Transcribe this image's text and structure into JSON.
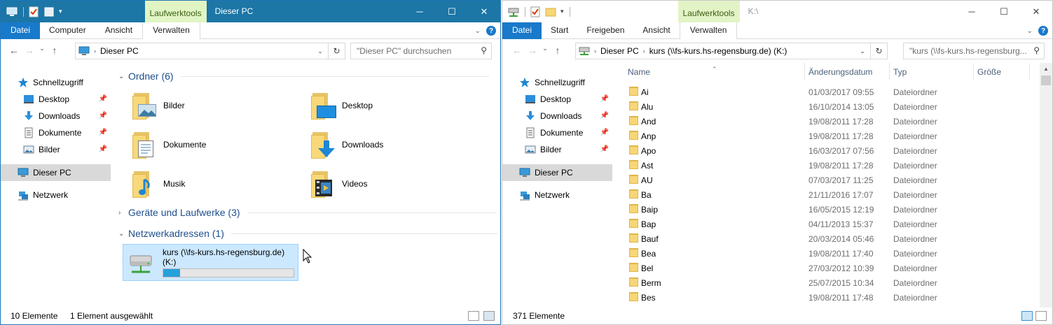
{
  "left": {
    "context_tab": "Laufwerktools",
    "title": "Dieser PC",
    "ribbon_tabs": [
      "Datei",
      "Computer",
      "Ansicht",
      "Verwalten"
    ],
    "address": "Dieser PC",
    "search_placeholder": "\"Dieser PC\" durchsuchen",
    "nav": {
      "quick_access": "Schnellzugriff",
      "items": [
        "Desktop",
        "Downloads",
        "Dokumente",
        "Bilder"
      ],
      "this_pc": "Dieser PC",
      "network": "Netzwerk"
    },
    "groups": {
      "folders": "Ordner (6)",
      "devices": "Geräte und Laufwerke (3)",
      "network": "Netzwerkadressen (1)"
    },
    "folders": [
      "Bilder",
      "Desktop",
      "Dokumente",
      "Downloads",
      "Musik",
      "Videos"
    ],
    "network_drive": {
      "line1": "kurs (\\\\fs-kurs.hs-regensburg.de)",
      "line2": "(K:)",
      "used_fraction": 0.13
    },
    "status": {
      "count": "10 Elemente",
      "selected": "1 Element ausgewählt"
    }
  },
  "right": {
    "context_tab": "Laufwerktools",
    "title": "K:\\",
    "ribbon_tabs": [
      "Datei",
      "Start",
      "Freigeben",
      "Ansicht",
      "Verwalten"
    ],
    "address": {
      "crumb1": "Dieser PC",
      "crumb2": "kurs (\\\\fs-kurs.hs-regensburg.de) (K:)"
    },
    "search_placeholder": "\"kurs (\\\\fs-kurs.hs-regensburg...",
    "nav": {
      "quick_access": "Schnellzugriff",
      "items": [
        "Desktop",
        "Downloads",
        "Dokumente",
        "Bilder"
      ],
      "this_pc": "Dieser PC",
      "network": "Netzwerk"
    },
    "columns": [
      "Name",
      "Änderungsdatum",
      "Typ",
      "Größe"
    ],
    "rows": [
      {
        "name": "Ai",
        "date": "01/03/2017 09:55",
        "type": "Dateiordner"
      },
      {
        "name": "Alu",
        "date": "16/10/2014 13:05",
        "type": "Dateiordner"
      },
      {
        "name": "And",
        "date": "19/08/2011 17:28",
        "type": "Dateiordner"
      },
      {
        "name": "Anp",
        "date": "19/08/2011 17:28",
        "type": "Dateiordner"
      },
      {
        "name": "Apo",
        "date": "16/03/2017 07:56",
        "type": "Dateiordner"
      },
      {
        "name": "Ast",
        "date": "19/08/2011 17:28",
        "type": "Dateiordner"
      },
      {
        "name": "AU",
        "date": "07/03/2017 11:25",
        "type": "Dateiordner"
      },
      {
        "name": "Ba",
        "date": "21/11/2016 17:07",
        "type": "Dateiordner"
      },
      {
        "name": "Baip",
        "date": "16/05/2015 12:19",
        "type": "Dateiordner"
      },
      {
        "name": "Bap",
        "date": "04/11/2013 15:37",
        "type": "Dateiordner"
      },
      {
        "name": "Bauf",
        "date": "20/03/2014 05:46",
        "type": "Dateiordner"
      },
      {
        "name": "Bea",
        "date": "19/08/2011 17:40",
        "type": "Dateiordner"
      },
      {
        "name": "Bel",
        "date": "27/03/2012 10:39",
        "type": "Dateiordner"
      },
      {
        "name": "Berm",
        "date": "25/07/2015 10:34",
        "type": "Dateiordner"
      },
      {
        "name": "Bes",
        "date": "19/08/2011 17:48",
        "type": "Dateiordner"
      }
    ],
    "status": {
      "count": "371 Elemente"
    }
  }
}
